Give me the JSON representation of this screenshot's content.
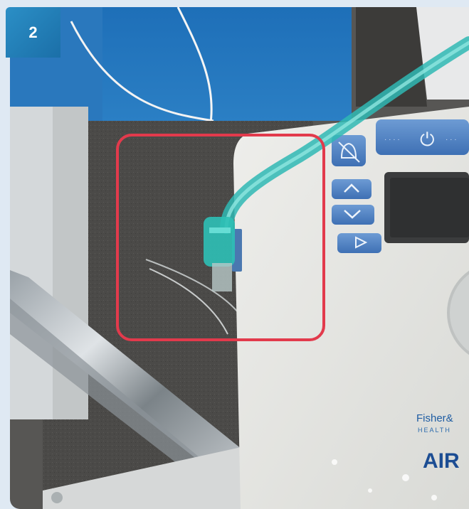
{
  "step_badge": "2",
  "device": {
    "brand": "Fisher&",
    "brand_sub": "HEALTH",
    "product": "AIR",
    "power_symbol": "⏻",
    "power_dots": "· · · ·"
  },
  "colors": {
    "badge": "#2188c4",
    "highlight": "#e23a4c",
    "tube": "#3ec6c2",
    "device_body": "#e7e8e4",
    "button": "#4a7fc0"
  },
  "icons": [
    "alarm-bell-icon",
    "power-icon",
    "up-arrow-icon",
    "down-arrow-icon",
    "right-arrow-icon"
  ]
}
